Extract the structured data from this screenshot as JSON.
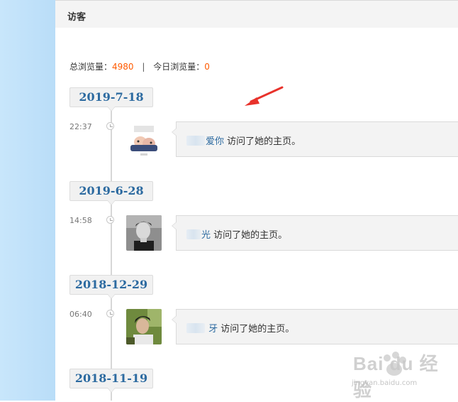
{
  "header": {
    "title": "访客"
  },
  "stats": {
    "total_label": "总浏览量：",
    "total_value": "4980",
    "separator": "|",
    "today_label": "今日浏览量：",
    "today_value": "0"
  },
  "timeline": [
    {
      "date": "2019-7-18",
      "time": "22:37",
      "username": "爱你",
      "action": "访问了她的主页。",
      "avatar": "cartoon-avatar"
    },
    {
      "date": "2019-6-28",
      "time": "14:58",
      "username": "光",
      "action": "访问了她的主页。",
      "avatar": "man-portrait-avatar"
    },
    {
      "date": "2018-12-29",
      "time": "06:40",
      "username": "牙",
      "action": "访问了她的主页。",
      "avatar": "boy-photo-avatar"
    },
    {
      "date": "2018-11-19"
    }
  ],
  "watermark": {
    "text": "Bai du 经验",
    "url": "jingyan.baidu.com"
  },
  "colors": {
    "accent": "#2c6aa0",
    "count": "#ff5a00",
    "arrow": "#e8322b",
    "sidebar": "#c8e6fb"
  }
}
